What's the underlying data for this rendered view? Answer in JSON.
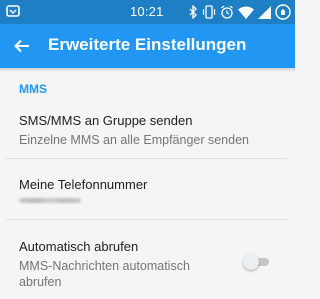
{
  "status_bar": {
    "time": "10:21",
    "left_icon": "android-system-icon",
    "right_icons": [
      "bluetooth-icon",
      "vibrate-icon",
      "alarm-icon",
      "wifi-icon",
      "signal-icon",
      "battery-icon"
    ]
  },
  "app_bar": {
    "title": "Erweiterte Einstellungen",
    "back_icon": "arrow-back-icon"
  },
  "section": {
    "header": "MMS"
  },
  "preferences": [
    {
      "title": "SMS/MMS an Gruppe senden",
      "summary": "Einzelne MMS an alle Empfänger senden"
    },
    {
      "title": "Meine Telefonnummer"
    },
    {
      "title": "Automatisch abrufen",
      "summary": "MMS-Nachrichten automatisch abrufen",
      "toggle_on": false
    }
  ],
  "colors": {
    "status_bar": "#1e7fc4",
    "app_bar": "#2196f3",
    "accent": "#2196f3",
    "background": "#f5f5f5"
  }
}
